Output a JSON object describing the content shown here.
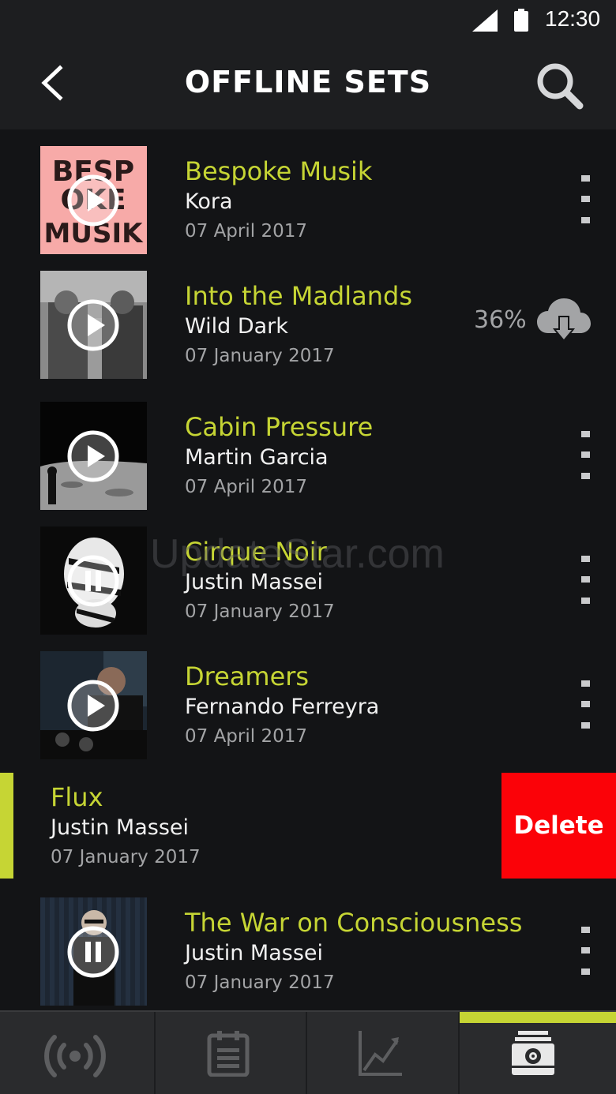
{
  "status_bar": {
    "time": "12:30"
  },
  "header": {
    "title": "OFFLINE SETS"
  },
  "sets": [
    {
      "title": "Bespoke Musik",
      "artist": "Kora",
      "date": "07 April 2017",
      "state": "play",
      "cover_lettering": "BESPOKE MUSIK"
    },
    {
      "title": "Into the Madlands",
      "artist": "Wild Dark",
      "date": "07 January 2017",
      "state": "play",
      "download_progress": "36%"
    },
    {
      "title": "Cabin Pressure",
      "artist": "Martin Garcia",
      "date": "07 April 2017",
      "state": "play"
    },
    {
      "title": "Cirque Noir",
      "artist": "Justin Massei",
      "date": "07 January 2017",
      "state": "pause"
    },
    {
      "title": "Dreamers",
      "artist": "Fernando Ferreyra",
      "date": "07 April 2017",
      "state": "play"
    },
    {
      "title": "The War on Consciousness",
      "artist": "Justin Massei",
      "date": "07 January 2017",
      "state": "pause"
    }
  ],
  "swiped_set": {
    "title": "Flux",
    "artist": "Justin Massei",
    "date": "07 January 2017",
    "delete_label": "Delete"
  },
  "watermark": "UpdateStar.com",
  "bottom_nav": {
    "tabs": [
      {
        "icon": "broadcast-icon",
        "active": false
      },
      {
        "icon": "calendar-icon",
        "active": false
      },
      {
        "icon": "trending-chart-icon",
        "active": false
      },
      {
        "icon": "offline-box-icon",
        "active": true
      }
    ]
  },
  "colors": {
    "accent": "#c6d534",
    "delete": "#fb0208",
    "background": "#131416",
    "bar": "#1d1e20"
  }
}
